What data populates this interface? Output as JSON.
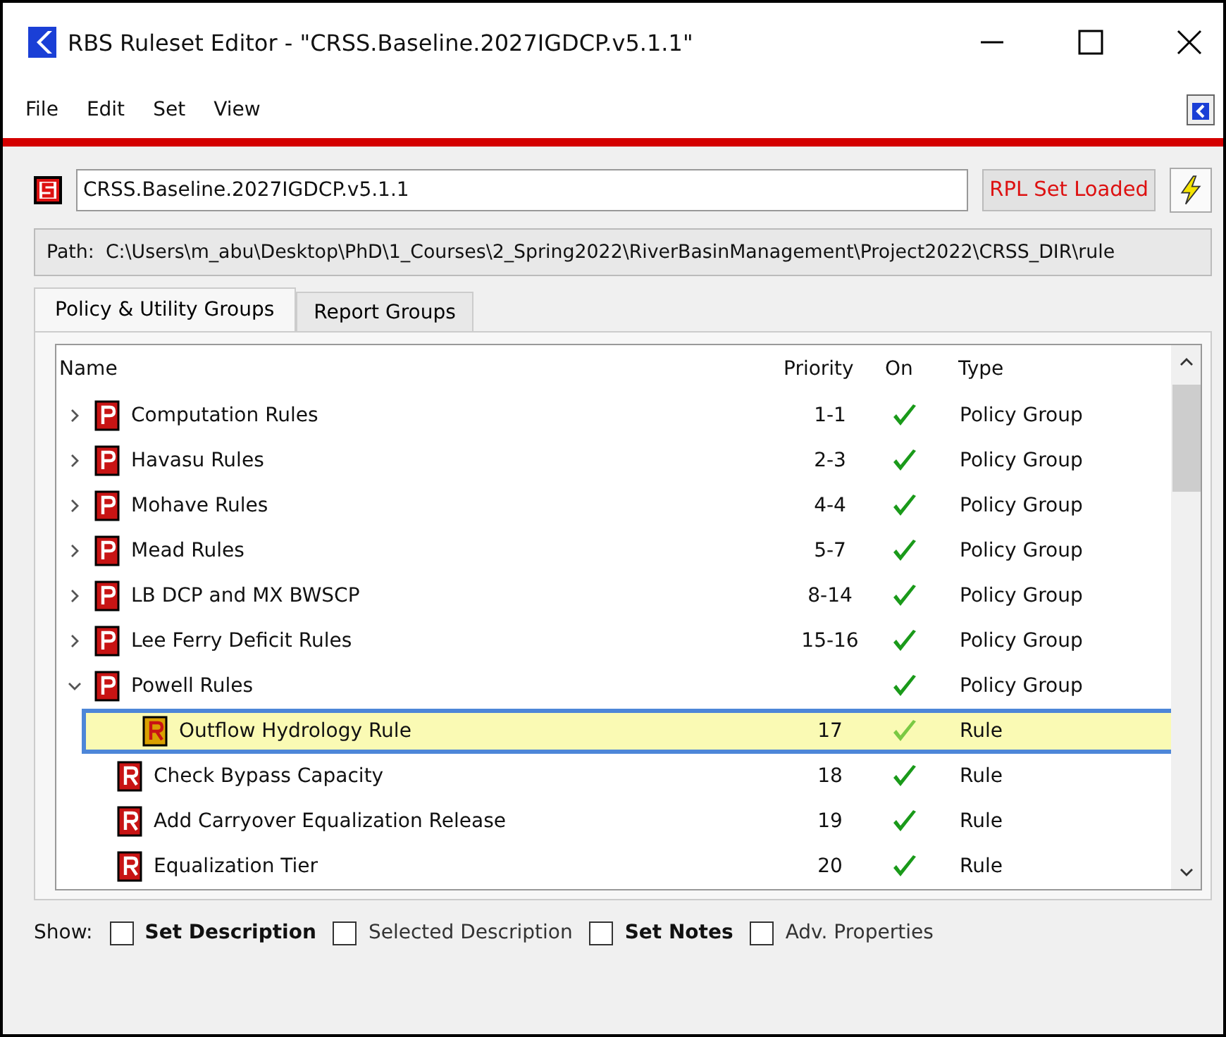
{
  "window": {
    "title": "RBS Ruleset Editor - \"CRSS.Baseline.2027IGDCP.v5.1.1\""
  },
  "menu": [
    "File",
    "Edit",
    "Set",
    "View"
  ],
  "ruleset": {
    "name": "CRSS.Baseline.2027IGDCP.v5.1.1",
    "status": "RPL Set Loaded"
  },
  "path": {
    "label": "Path:",
    "value": "C:\\Users\\m_abu\\Desktop\\PhD\\1_Courses\\2_Spring2022\\RiverBasinManagement\\Project2022\\CRSS_DIR\\rule"
  },
  "tabs": [
    {
      "label": "Policy & Utility Groups",
      "selected": true
    },
    {
      "label": "Report Groups",
      "selected": false
    }
  ],
  "table": {
    "columns": [
      "Name",
      "Priority",
      "On",
      "Type"
    ],
    "rows": [
      {
        "name": "Computation Rules",
        "priority": "1-1",
        "on": true,
        "type": "Policy Group",
        "expanded": false,
        "selected": false
      },
      {
        "name": "Havasu Rules",
        "priority": "2-3",
        "on": true,
        "type": "Policy Group",
        "expanded": false,
        "selected": false
      },
      {
        "name": "Mohave Rules",
        "priority": "4-4",
        "on": true,
        "type": "Policy Group",
        "expanded": false,
        "selected": false
      },
      {
        "name": "Mead Rules",
        "priority": "5-7",
        "on": true,
        "type": "Policy Group",
        "expanded": false,
        "selected": false
      },
      {
        "name": "LB DCP and MX BWSCP",
        "priority": "8-14",
        "on": true,
        "type": "Policy Group",
        "expanded": false,
        "selected": false
      },
      {
        "name": "Lee Ferry Deficit Rules",
        "priority": "15-16",
        "on": true,
        "type": "Policy Group",
        "expanded": false,
        "selected": false
      },
      {
        "name": "Powell Rules",
        "on": true,
        "type": "Policy Group",
        "expanded": true,
        "selected": false,
        "children": [
          {
            "name": "Outflow Hydrology Rule",
            "priority": "17",
            "on": true,
            "type": "Rule",
            "selected": true
          },
          {
            "name": "Check Bypass Capacity",
            "priority": "18",
            "on": true,
            "type": "Rule",
            "selected": false
          },
          {
            "name": "Add Carryover Equalization Release",
            "priority": "19",
            "on": true,
            "type": "Rule",
            "selected": false
          },
          {
            "name": "Equalization Tier",
            "priority": "20",
            "on": true,
            "type": "Rule",
            "selected": false
          }
        ]
      }
    ]
  },
  "show": {
    "label": "Show:",
    "options": [
      {
        "label": "Set Description",
        "checked": false,
        "bold": true
      },
      {
        "label": "Selected Description",
        "checked": false,
        "bold": false
      },
      {
        "label": "Set Notes",
        "checked": false,
        "bold": true
      },
      {
        "label": "Adv. Properties",
        "checked": false,
        "bold": false
      }
    ]
  }
}
